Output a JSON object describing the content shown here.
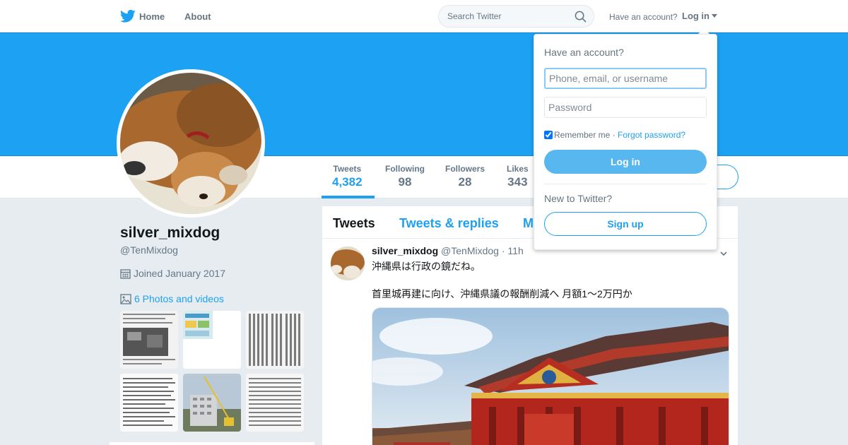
{
  "nav": {
    "home": "Home",
    "about": "About",
    "search_placeholder": "Search Twitter",
    "have_account": "Have an account?",
    "login": "Log in"
  },
  "profile": {
    "name": "silver_mixdog",
    "handle": "@TenMixdog",
    "joined": "Joined January 2017",
    "photos_link": "6 Photos and videos"
  },
  "stats": [
    {
      "label": "Tweets",
      "value": "4,382"
    },
    {
      "label": "Following",
      "value": "98"
    },
    {
      "label": "Followers",
      "value": "28"
    },
    {
      "label": "Likes",
      "value": "343"
    }
  ],
  "timeline": {
    "tabs": [
      "Tweets",
      "Tweets & replies",
      "M"
    ],
    "tweet": {
      "name": "silver_mixdog",
      "handle": "@TenMixdog",
      "time": "· 11h",
      "text1": "沖縄県は行政の鏡だね。",
      "text2": "首里城再建に向け、沖縄県議の報酬削減へ 月額1～2万円か"
    }
  },
  "login_dropdown": {
    "title": "Have an account?",
    "username_placeholder": "Phone, email, or username",
    "password_placeholder": "Password",
    "remember": "Remember me",
    "separator": " · ",
    "forgot": "Forgot password?",
    "login_button": "Log in",
    "new_to": "New to Twitter?",
    "signup_button": "Sign up"
  },
  "colors": {
    "brand": "#1da1f2",
    "background": "#e6ecf0",
    "muted_text": "#657786"
  }
}
